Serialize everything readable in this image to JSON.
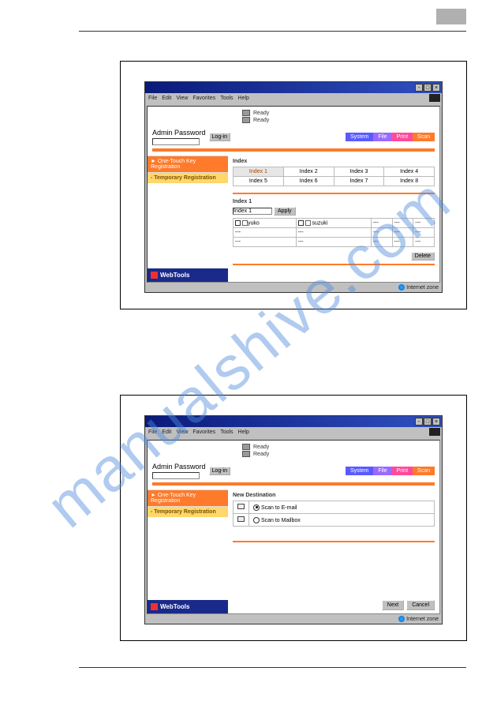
{
  "watermark": "manualshive.com",
  "menu": {
    "file": "File",
    "edit": "Edit",
    "view": "View",
    "favorites": "Favorites",
    "tools": "Tools",
    "help": "Help"
  },
  "status": {
    "ready1": "Ready",
    "ready2": "Ready"
  },
  "admin": {
    "label": "Admin Password",
    "login": "Log-in"
  },
  "tabs": {
    "system": "System",
    "file": "File",
    "print": "Print",
    "scan": "Scan"
  },
  "sidebar": {
    "one_touch": "► One-Touch Key Registration",
    "temporary": "- Temporary Registration",
    "webtools": "WebTools"
  },
  "screen1": {
    "section_index": "Index",
    "index_cells": [
      "Index 1",
      "Index 2",
      "Index 3",
      "Index 4",
      "Index 5",
      "Index 6",
      "Index 7",
      "Index 8"
    ],
    "section_index1": "Index 1",
    "apply_label": "Apply",
    "input_value": "Index 1",
    "grid": {
      "r0c0": "yuko",
      "r0c1": "suzuki",
      "r0c2": "---",
      "r0c3": "---",
      "r0c4": "---",
      "r1c0": "---",
      "r1c1": "---",
      "r1c2": "---",
      "r1c3": "---",
      "r1c4": "---",
      "r2c0": "---",
      "r2c1": "---",
      "r2c2": "---",
      "r2c3": "---",
      "r2c4": "---"
    },
    "delete": "Delete"
  },
  "screen2": {
    "title": "New Destination",
    "opt1": "Scan to E-mail",
    "opt2": "Scan to Mailbox",
    "next": "Next",
    "cancel": "Cancel"
  },
  "statusbar": "Internet zone"
}
